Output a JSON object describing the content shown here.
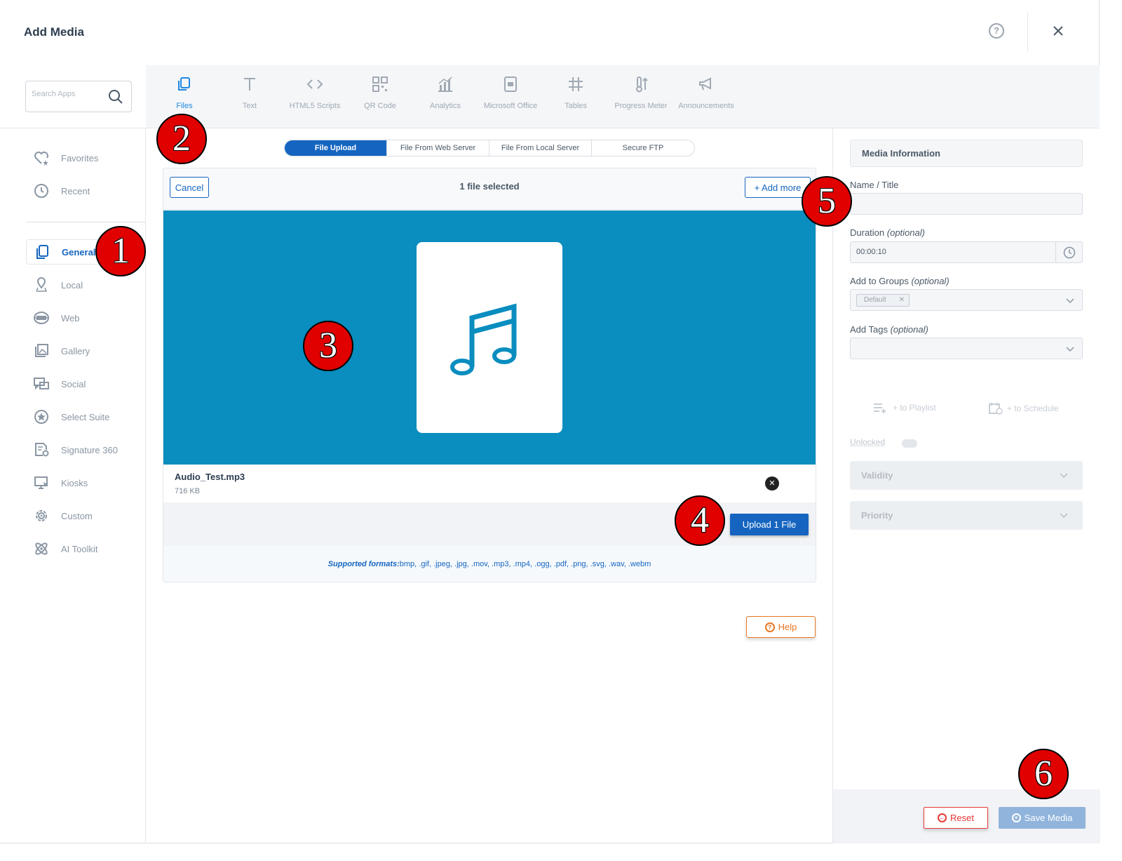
{
  "header": {
    "title": "Add Media",
    "help_icon": "question-circle-icon",
    "close_icon": "close-icon"
  },
  "search": {
    "placeholder": "Search Apps"
  },
  "sidebar": {
    "items": [
      {
        "label": "Favorites",
        "icon": "heart-star-icon"
      },
      {
        "label": "Recent",
        "icon": "clock-icon"
      },
      {
        "label": "General",
        "icon": "copy-icon",
        "active": true
      },
      {
        "label": "Local",
        "icon": "map-pin-icon"
      },
      {
        "label": "Web",
        "icon": "web-icon"
      },
      {
        "label": "Gallery",
        "icon": "gallery-icon"
      },
      {
        "label": "Social",
        "icon": "chat-bubbles-icon"
      },
      {
        "label": "Select Suite",
        "icon": "star-circle-icon"
      },
      {
        "label": "Signature 360",
        "icon": "signature-doc-icon"
      },
      {
        "label": "Kiosks",
        "icon": "monitor-cursor-icon"
      },
      {
        "label": "Custom",
        "icon": "gear-play-icon"
      },
      {
        "label": "AI Toolkit",
        "icon": "atom-icon"
      }
    ]
  },
  "app_tabs": [
    {
      "label": "Files",
      "icon": "files-icon",
      "active": true
    },
    {
      "label": "Text",
      "icon": "text-icon"
    },
    {
      "label": "HTML5 Scripts",
      "icon": "code-icon"
    },
    {
      "label": "QR Code",
      "icon": "qr-code-icon"
    },
    {
      "label": "Analytics",
      "icon": "analytics-icon"
    },
    {
      "label": "Microsoft Office",
      "icon": "office-doc-icon"
    },
    {
      "label": "Tables",
      "icon": "hash-grid-icon"
    },
    {
      "label": "Progress Meter",
      "icon": "thermometer-icon"
    },
    {
      "label": "Announcements",
      "icon": "megaphone-icon"
    }
  ],
  "upload_modes": [
    {
      "label": "File Upload",
      "active": true
    },
    {
      "label": "File From Web Server"
    },
    {
      "label": "File From Local Server"
    },
    {
      "label": "Secure FTP"
    }
  ],
  "uploader": {
    "cancel_label": "Cancel",
    "selected_text": "1 file selected",
    "add_more_label": "+ Add more",
    "preview_icon": "music-note-icon",
    "file_name": "Audio_Test.mp3",
    "file_size": "716 KB",
    "remove_icon": "x-circle-icon",
    "upload_label": "Upload 1 File",
    "formats_label": "Supported formats:",
    "formats_list": "bmp, .gif, .jpeg, .jpg, .mov, .mp3, .mp4, .ogg, .pdf, .png, .svg, .wav, .webm",
    "preview_color": "#0a8dbf"
  },
  "help_button": {
    "label": "Help"
  },
  "media_info": {
    "header": "Media Information",
    "name_label": "Name / Title",
    "name_value": "",
    "duration_label": "Duration",
    "optional": "(optional)",
    "duration_value": "00:00:10",
    "groups_label": "Add to Groups",
    "group_chip": "Default",
    "tags_label": "Add Tags",
    "to_playlist": "+ to Playlist",
    "to_schedule": "+ to Schedule",
    "unlocked_label": "Unlocked",
    "validity_label": "Validity",
    "priority_label": "Priority",
    "reset_label": "Reset",
    "save_label": "Save Media"
  },
  "callouts": [
    "1",
    "2",
    "3",
    "4",
    "5",
    "6"
  ],
  "colors": {
    "primary": "#1565c0",
    "accent_orange": "#e87722",
    "danger": "#e53935",
    "callout_red": "#e00000"
  }
}
